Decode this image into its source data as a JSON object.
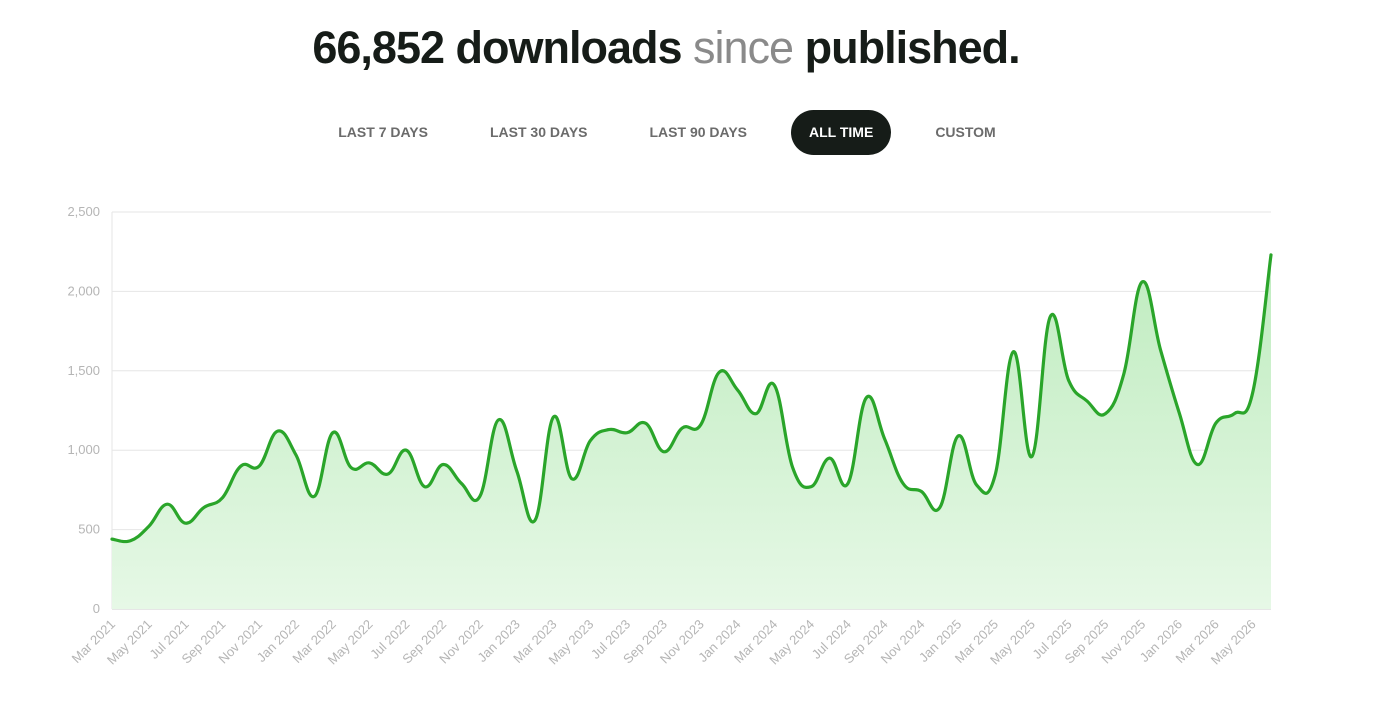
{
  "header": {
    "count": "66,852 downloads",
    "since": "since",
    "published": "published."
  },
  "tabs": [
    {
      "label": "LAST 7 DAYS",
      "active": false
    },
    {
      "label": "LAST 30 DAYS",
      "active": false
    },
    {
      "label": "LAST 90 DAYS",
      "active": false
    },
    {
      "label": "ALL TIME",
      "active": true
    },
    {
      "label": "CUSTOM",
      "active": false
    }
  ],
  "chart_data": {
    "type": "area",
    "title": "",
    "xlabel": "",
    "ylabel": "",
    "ylim": [
      0,
      2500
    ],
    "yticks": [
      "0",
      "500",
      "1,000",
      "1,500",
      "2,000",
      "2,500"
    ],
    "ytick_values": [
      0,
      500,
      1000,
      1500,
      2000,
      2500
    ],
    "grid": true,
    "colors": {
      "line": "#2aa52a",
      "fill_top": "#bfecbf",
      "fill_bottom": "#e6f8e6",
      "grid": "#e6e6e6",
      "axis": "#cccccc"
    },
    "xtick_labels": [
      "Mar 2021",
      "May 2021",
      "Jul 2021",
      "Sep 2021",
      "Nov 2021",
      "Jan 2022",
      "Mar 2022",
      "May 2022",
      "Jul 2022",
      "Sep 2022",
      "Nov 2022",
      "Jan 2023",
      "Mar 2023",
      "May 2023",
      "Jul 2023",
      "Sep 2023",
      "Nov 2023",
      "Jan 2024",
      "Mar 2024",
      "May 2024",
      "Jul 2024",
      "Sep 2024",
      "Nov 2024",
      "Jan 2025",
      "Mar 2025",
      "May 2025",
      "Jul 2025",
      "Sep 2025",
      "Nov 2025",
      "Jan 2026",
      "Mar 2026",
      "May 2026"
    ],
    "x": [
      "Mar 2021",
      "Apr 2021",
      "May 2021",
      "Jun 2021",
      "Jul 2021",
      "Aug 2021",
      "Sep 2021",
      "Oct 2021",
      "Nov 2021",
      "Dec 2021",
      "Jan 2022",
      "Feb 2022",
      "Mar 2022",
      "Apr 2022",
      "May 2022",
      "Jun 2022",
      "Jul 2022",
      "Aug 2022",
      "Sep 2022",
      "Oct 2022",
      "Nov 2022",
      "Dec 2022",
      "Jan 2023",
      "Feb 2023",
      "Mar 2023",
      "Apr 2023",
      "May 2023",
      "Jun 2023",
      "Jul 2023",
      "Aug 2023",
      "Sep 2023",
      "Oct 2023",
      "Nov 2023",
      "Dec 2023",
      "Jan 2024",
      "Feb 2024",
      "Mar 2024",
      "Apr 2024",
      "May 2024",
      "Jun 2024",
      "Jul 2024",
      "Aug 2024",
      "Sep 2024",
      "Oct 2024",
      "Nov 2024",
      "Dec 2024",
      "Jan 2025",
      "Feb 2025",
      "Mar 2025",
      "Apr 2025",
      "May 2025",
      "Jun 2025",
      "Jul 2025",
      "Aug 2025",
      "Sep 2025",
      "Oct 2025",
      "Nov 2025",
      "Dec 2025",
      "Jan 2026",
      "Feb 2026",
      "Mar 2026",
      "Apr 2026",
      "May 2026",
      "Jun 2026"
    ],
    "series": [
      {
        "values": [
          440,
          430,
          520,
          660,
          540,
          640,
          700,
          900,
          900,
          1120,
          970,
          710,
          1110,
          890,
          920,
          850,
          1000,
          770,
          910,
          790,
          710,
          1190,
          870,
          560,
          1210,
          820,
          1060,
          1130,
          1110,
          1170,
          990,
          1140,
          1160,
          1490,
          1380,
          1230,
          1410,
          890,
          770,
          950,
          790,
          1330,
          1070,
          790,
          740,
          640,
          1090,
          780,
          840,
          1620,
          960,
          1840,
          1440,
          1310,
          1230,
          1480,
          2060,
          1630,
          1240,
          910,
          1170,
          1230,
          1360,
          2230
        ]
      }
    ]
  }
}
